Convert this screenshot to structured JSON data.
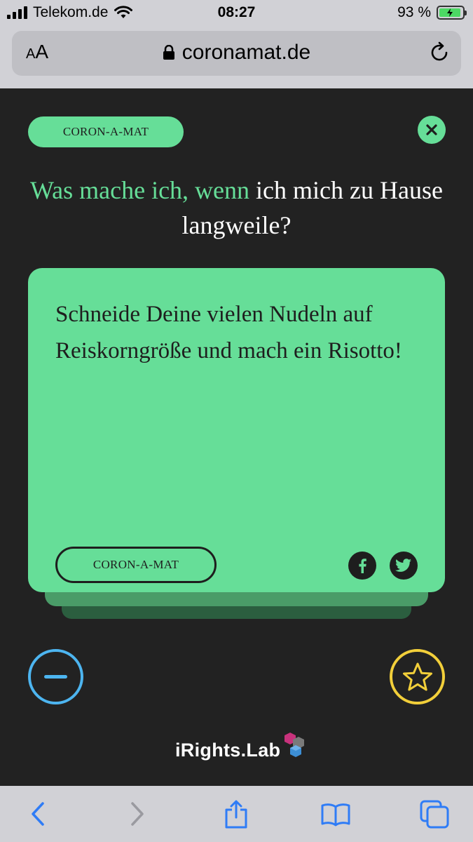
{
  "status_bar": {
    "carrier": "Telekom.de",
    "time": "08:27",
    "battery": "93 %",
    "battery_level": 0.93
  },
  "address_bar": {
    "text_size_label": "AA",
    "url": "coronamat.de"
  },
  "page": {
    "badge_label": "CORON-A-MAT",
    "question_highlight": "Was mache ich, wenn",
    "question_rest": "ich mich zu Hause langweile?",
    "card": {
      "text": "Schneide Deine vielen Nudeln auf Reiskorngröße und mach ein Risotto!",
      "badge_label": "CORON-A-MAT"
    },
    "logo_text": "iRights.Lab"
  },
  "colors": {
    "background": "#222222",
    "accent_green": "#66de98",
    "minus_blue": "#4db5f0",
    "star_yellow": "#f2cf3a",
    "ios_blue": "#2f7cf6"
  },
  "icons": {
    "close": "close-icon",
    "facebook": "facebook-icon",
    "twitter": "twitter-icon",
    "minus": "minus-icon",
    "star": "star-icon",
    "back": "chevron-left-icon",
    "forward": "chevron-right-icon",
    "share": "share-icon",
    "bookmarks": "book-icon",
    "tabs": "tabs-icon"
  }
}
